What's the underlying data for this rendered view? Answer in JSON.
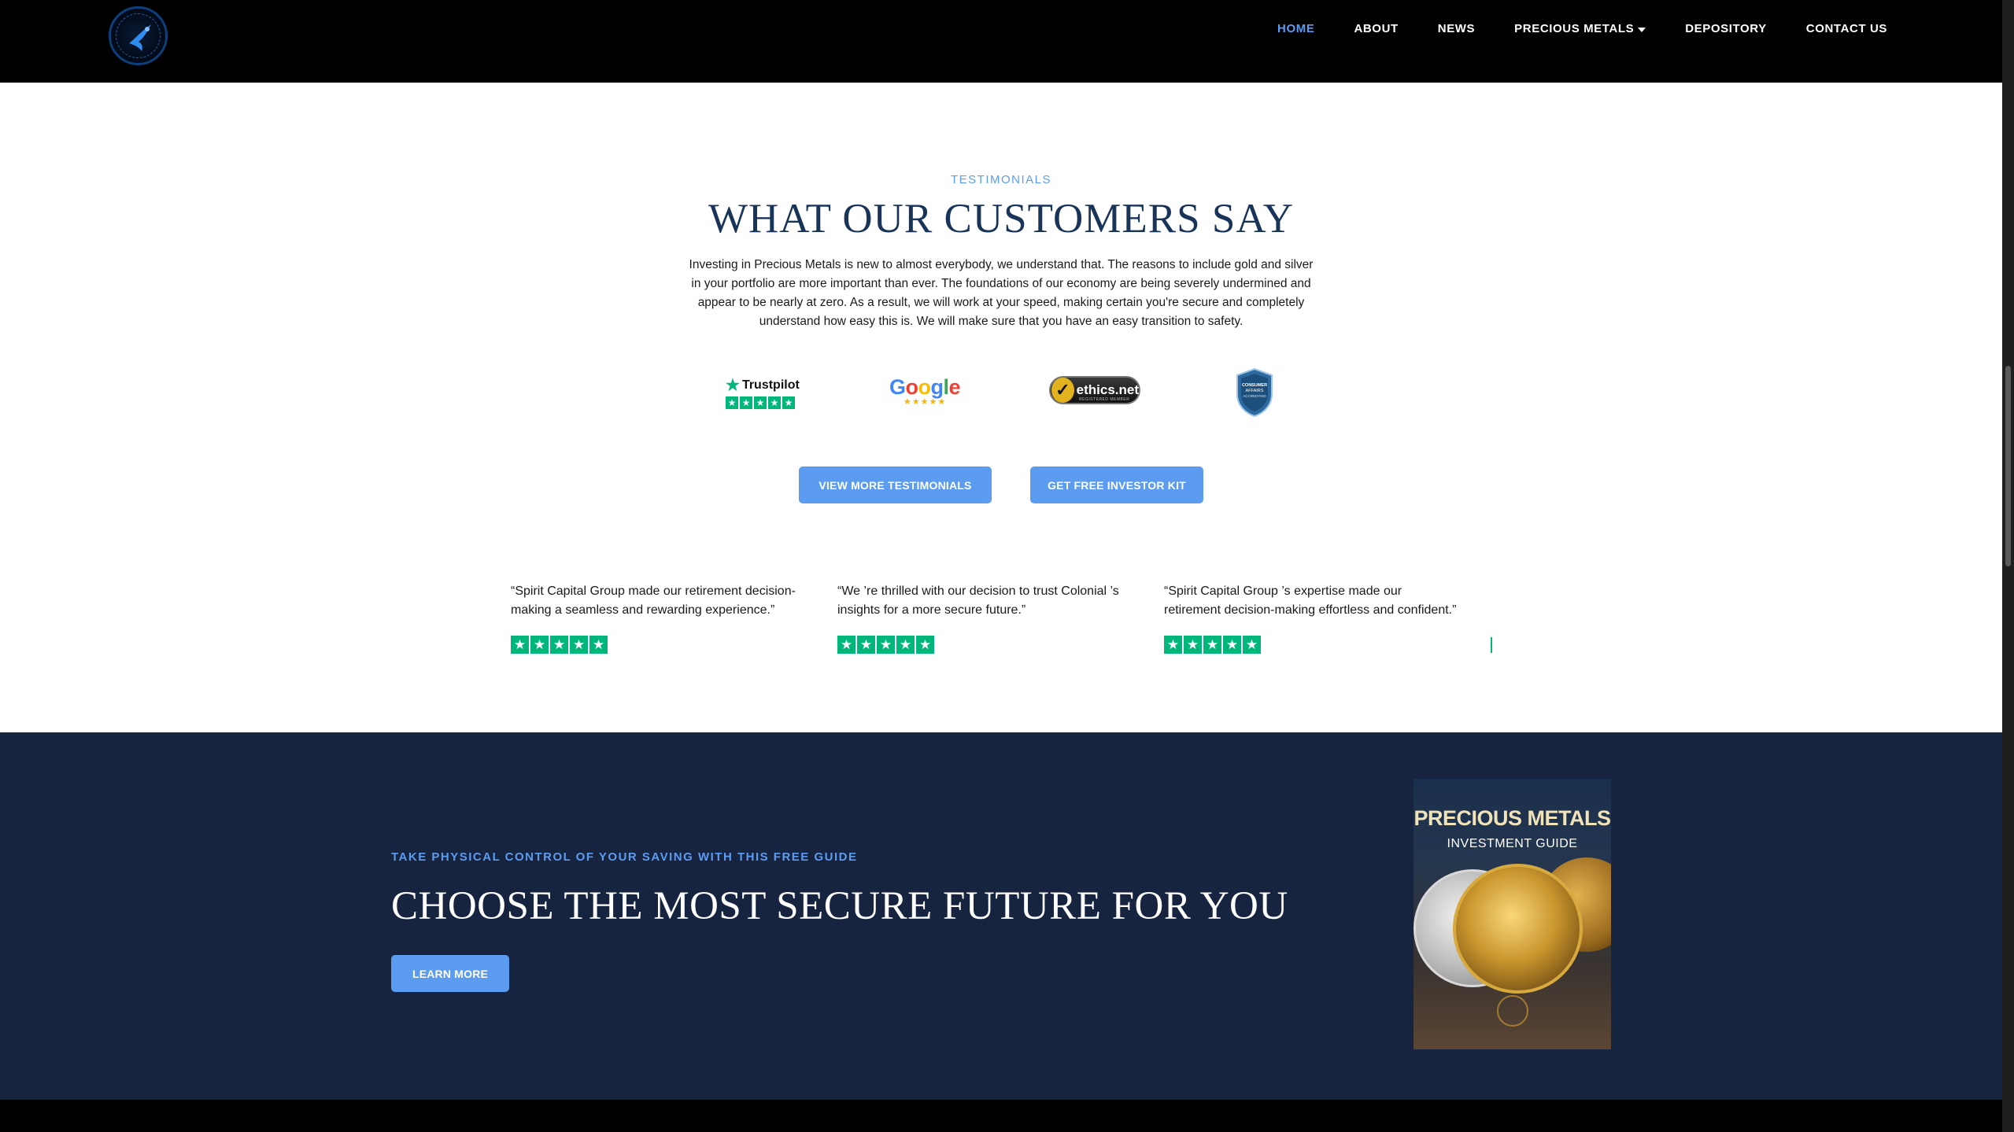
{
  "nav": {
    "links": [
      {
        "label": "HOME",
        "active": true
      },
      {
        "label": "ABOUT"
      },
      {
        "label": "NEWS"
      },
      {
        "label": "PRECIOUS METALS"
      },
      {
        "label": "DEPOSITORY"
      },
      {
        "label": "CONTACT US"
      }
    ]
  },
  "testimonials": {
    "eyebrow": "TESTIMONIALS",
    "heading": "WHAT OUR CUSTOMERS SAY",
    "intro": "Investing in Precious Metals is new to almost everybody, we understand that. The reasons to include gold and silver in your portfolio are more important than ever. The foundations of our economy are being severely undermined and appear to be nearly at zero. As a result, we will work at your speed, making certain you're secure and completely understand how easy this is. We will make sure that you have an easy transition to safety.",
    "badges": {
      "trustpilot": "Trustpilot",
      "google": "Google",
      "ethics": "ethics.net",
      "ethics_sub": "REGISTERED MEMBER",
      "consumer": [
        "CONSUMER",
        "AFFAIRS",
        "ACCREDITED"
      ]
    },
    "btn_view": "VIEW MORE TESTIMONIALS",
    "btn_kit": "GET FREE INVESTOR KIT",
    "quotes": [
      {
        "text": "“Spirit Capital Group made our retirement decision-making a seamless and rewarding experience.”",
        "rating": 5
      },
      {
        "text": "“We ’re thrilled with our decision to trust Colonial ’s insights for a more secure future.”",
        "rating": 5
      },
      {
        "text": "“Spirit Capital Group ’s expertise made our retirement decision-making effortless and confident.”",
        "rating": 5
      }
    ]
  },
  "guide": {
    "eyebrow": "TAKE PHYSICAL CONTROL OF YOUR SAVING WITH THIS FREE GUIDE",
    "title": "CHOOSE THE MOST SECURE FUTURE FOR YOU",
    "btn_learn": "LEARN MORE",
    "book_title": "PRECIOUS METALS",
    "book_sub": "INVESTMENT GUIDE"
  },
  "colors": {
    "accent": "#5c9cf0",
    "heading": "#183459",
    "dark_bg": "#172440",
    "trustpilot_green": "#00b67a"
  }
}
